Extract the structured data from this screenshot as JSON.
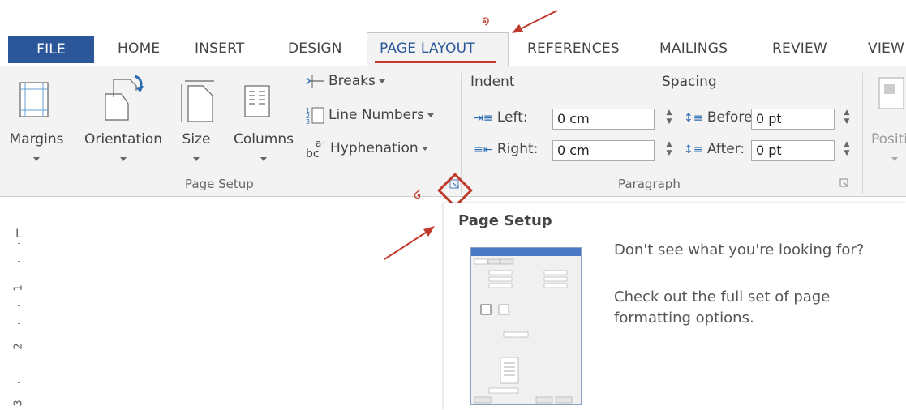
{
  "tabs": [
    {
      "id": "file",
      "label": "FILE"
    },
    {
      "id": "home",
      "label": "HOME"
    },
    {
      "id": "insert",
      "label": "INSERT"
    },
    {
      "id": "design",
      "label": "DESIGN"
    },
    {
      "id": "page_layout",
      "label": "PAGE LAYOUT",
      "active": true
    },
    {
      "id": "references",
      "label": "REFERENCES"
    },
    {
      "id": "mailings",
      "label": "MAILINGS"
    },
    {
      "id": "review",
      "label": "REVIEW"
    },
    {
      "id": "view",
      "label": "VIEW"
    }
  ],
  "page_setup": {
    "margins": "Margins",
    "orientation": "Orientation",
    "size": "Size",
    "columns": "Columns",
    "breaks": "Breaks",
    "line_numbers": "Line Numbers",
    "hyphenation": "Hyphenation",
    "group_label": "Page Setup"
  },
  "paragraph": {
    "indent_heading": "Indent",
    "spacing_heading": "Spacing",
    "left_label": "Left:",
    "left_value": "0 cm",
    "right_label": "Right:",
    "right_value": "0 cm",
    "before_label": "Before:",
    "before_value": "0 pt",
    "after_label": "After:",
    "after_value": "0 pt",
    "group_label": "Paragraph"
  },
  "arrange": {
    "position_label": "Positi"
  },
  "ruler": {
    "corner": "L",
    "numbers": [
      "1",
      "2",
      "3"
    ]
  },
  "tooltip": {
    "title": "Page Setup",
    "line1": "Don't see what you're looking for?",
    "line2": "Check out the full set of page formatting options."
  },
  "annotations": {
    "one": "໑",
    "two": "໒"
  },
  "colors": {
    "file_tab": "#2b579a",
    "accent_red": "#c0392b",
    "ribbon_bg": "#f3f3f3"
  }
}
